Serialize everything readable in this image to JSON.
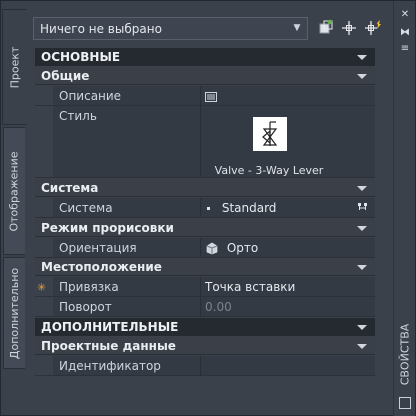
{
  "left_tabs": [
    "Проект",
    "Отображение",
    "Дополнительно"
  ],
  "right_strip": {
    "title": "СВОЙСТВА"
  },
  "selector": {
    "value": "Ничего не выбрано"
  },
  "categories": {
    "main": "ОСНОВНЫЕ",
    "extra": "ДОПОЛНИТЕЛЬНЫЕ"
  },
  "groups": {
    "general": "Общие",
    "system": "Система",
    "draw_mode": "Режим прорисовки",
    "location": "Местоположение",
    "project_data": "Проектные данные"
  },
  "rows": {
    "description": {
      "label": "Описание",
      "value": ""
    },
    "style": {
      "label": "Стиль",
      "caption": "Valve - 3-Way Lever"
    },
    "system": {
      "label": "Система",
      "value": "Standard"
    },
    "orientation": {
      "label": "Ориентация",
      "value": "Орто"
    },
    "anchor": {
      "label": "Привязка",
      "value": "Точка вставки"
    },
    "rotation": {
      "label": "Поворот",
      "value": "0.00"
    },
    "identifier": {
      "label": "Идентификатор",
      "value": ""
    }
  },
  "colors": {
    "accent_star": "#e3a23a",
    "category_bg": "#252a31"
  }
}
